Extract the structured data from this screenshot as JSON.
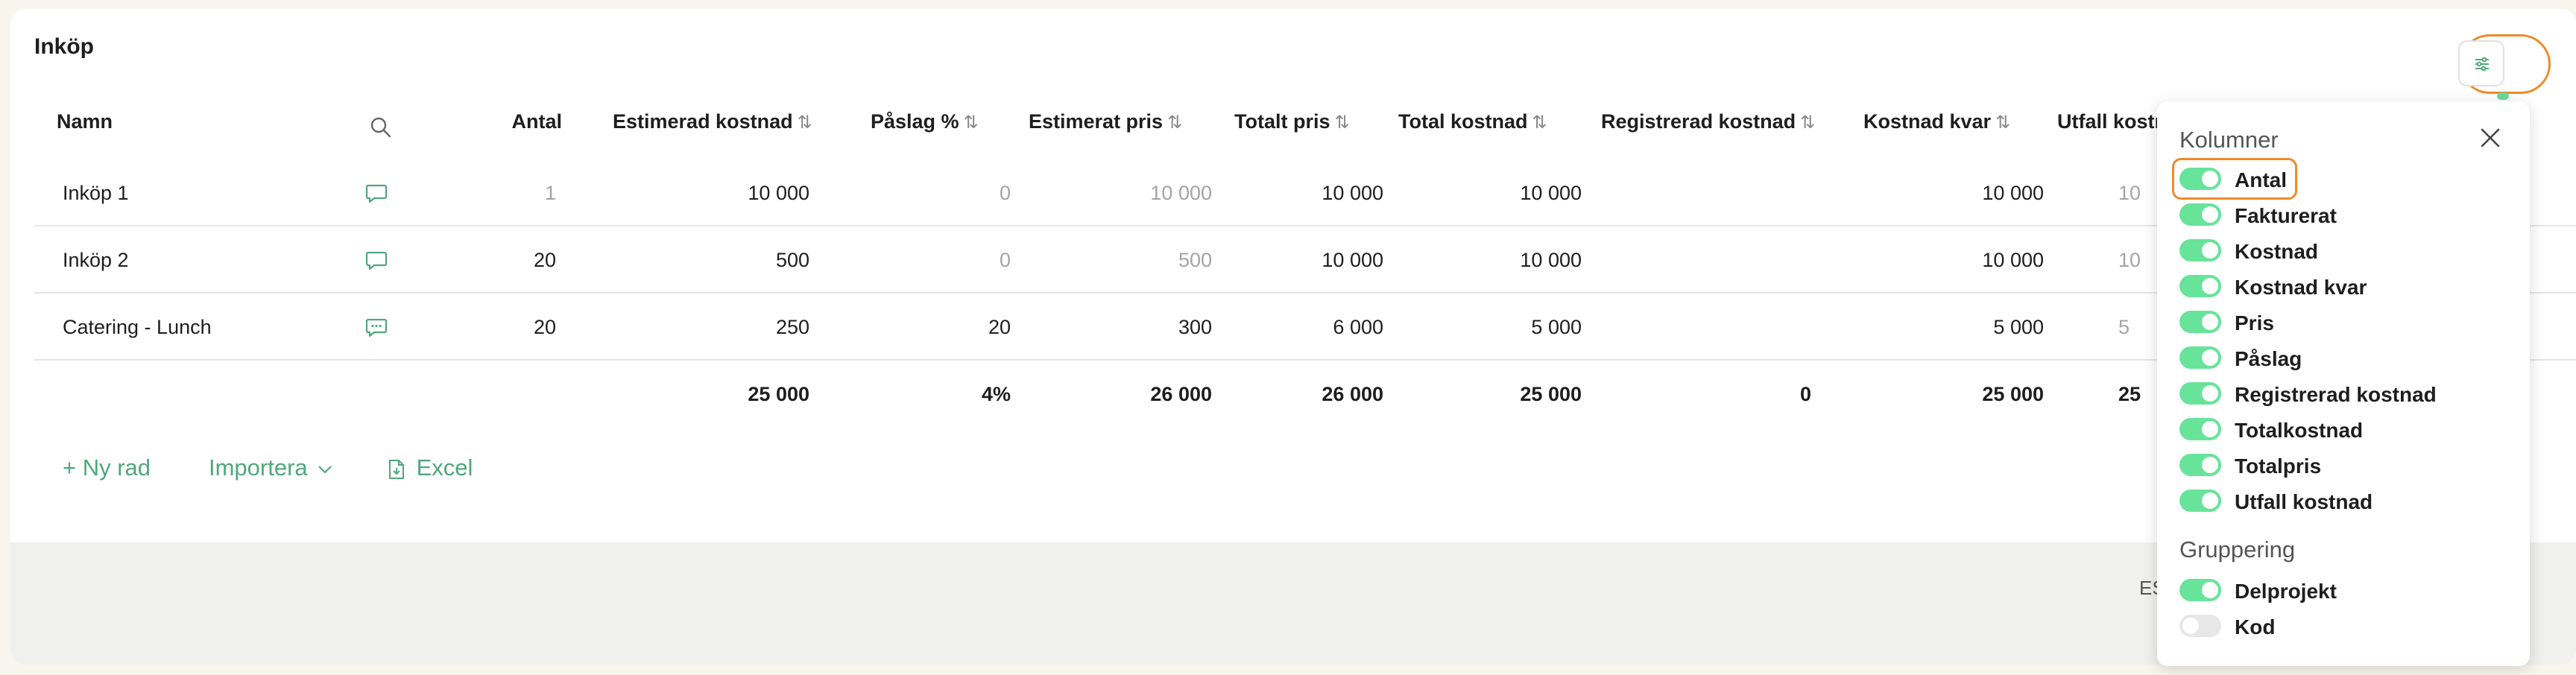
{
  "section_title": "Inköp",
  "columns": {
    "name": "Namn",
    "antal": "Antal",
    "est_kostnad": "Estimerad kostnad",
    "paslag": "Påslag %",
    "est_pris": "Estimerat pris",
    "totalt_pris": "Totalt pris",
    "total_kostnad": "Total kostnad",
    "reg_kostnad": "Registrerad kostnad",
    "kostnad_kvar": "Kostnad kvar",
    "utfall_kostnad": "Utfall kostn"
  },
  "sort_glyph": "⇅",
  "rows": [
    {
      "name": "Inköp 1",
      "antal": "1",
      "est_kostnad": "10 000",
      "paslag": "0",
      "est_pris": "10 000",
      "totalt_pris": "10 000",
      "total_kostnad": "10 000",
      "reg_kostnad": "",
      "kostnad_kvar": "10 000",
      "utfall": "10"
    },
    {
      "name": "Inköp 2",
      "antal": "20",
      "est_kostnad": "500",
      "paslag": "0",
      "est_pris": "500",
      "totalt_pris": "10 000",
      "total_kostnad": "10 000",
      "reg_kostnad": "",
      "kostnad_kvar": "10 000",
      "utfall": "10"
    },
    {
      "name": "Catering - Lunch",
      "antal": "20",
      "est_kostnad": "250",
      "paslag": "20",
      "est_pris": "300",
      "totalt_pris": "6 000",
      "total_kostnad": "5 000",
      "reg_kostnad": "",
      "kostnad_kvar": "5 000",
      "utfall": "5"
    }
  ],
  "totals": {
    "est_kostnad": "25 000",
    "paslag": "4%",
    "est_pris": "26 000",
    "totalt_pris": "26 000",
    "total_kostnad": "25 000",
    "reg_kostnad": "0",
    "kostnad_kvar": "25 000",
    "utfall": "25"
  },
  "actions": {
    "new_row": "+ Ny rad",
    "import": "Importera",
    "excel": "Excel"
  },
  "footer_partial": "ES",
  "panel": {
    "columns_heading": "Kolumner",
    "column_options": [
      {
        "label": "Antal",
        "on": true
      },
      {
        "label": "Fakturerat",
        "on": true
      },
      {
        "label": "Kostnad",
        "on": true
      },
      {
        "label": "Kostnad kvar",
        "on": true
      },
      {
        "label": "Pris",
        "on": true
      },
      {
        "label": "Påslag",
        "on": true
      },
      {
        "label": "Registrerad kostnad",
        "on": true
      },
      {
        "label": "Totalkostnad",
        "on": true
      },
      {
        "label": "Totalpris",
        "on": true
      },
      {
        "label": "Utfall kostnad",
        "on": true
      }
    ],
    "grouping_heading": "Gruppering",
    "grouping_options": [
      {
        "label": "Delprojekt",
        "on": true
      },
      {
        "label": "Kod",
        "on": false
      }
    ]
  },
  "colors": {
    "accent_green": "#4fa77c",
    "toggle_on": "#68e39a",
    "highlight_orange": "#ef8a2b"
  }
}
